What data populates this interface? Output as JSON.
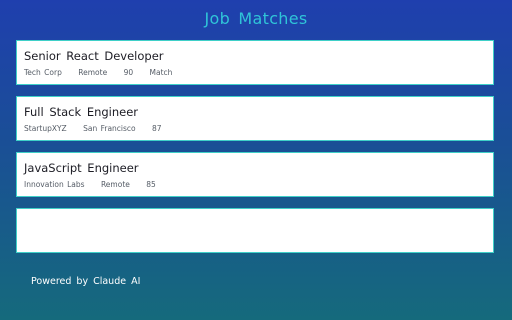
{
  "page": {
    "title": "Job Matches",
    "footer": "Powered by Claude AI"
  },
  "jobs": [
    {
      "title": "Senior React Developer",
      "company": "Tech Corp",
      "location": "Remote",
      "score": "90",
      "score_label": "Match"
    },
    {
      "title": "Full Stack Engineer",
      "company": "StartupXYZ",
      "location": "San Francisco",
      "score": "87"
    },
    {
      "title": "JavaScript Engineer",
      "company": "Innovation Labs",
      "location": "Remote",
      "score": "85"
    }
  ],
  "colors": {
    "title": "#2fc4d8",
    "card_border": "#3fd0c8",
    "background_top": "#1f3fae",
    "background_bottom": "#156a7c"
  }
}
